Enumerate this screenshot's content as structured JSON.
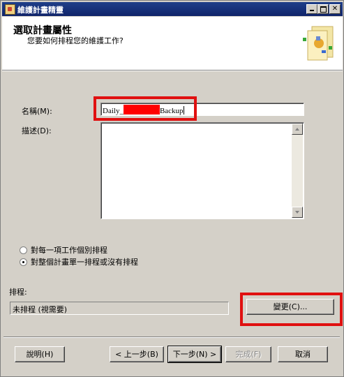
{
  "window": {
    "title": "維護計畫精靈"
  },
  "header": {
    "title": "選取計畫屬性",
    "subtitle": "您要如何排程您的維護工作?"
  },
  "form": {
    "name_label": "名稱(M):",
    "name_value_prefix": "Daily_",
    "name_value_suffix": "Backup",
    "description_label": "描述(D):",
    "description_value": ""
  },
  "schedule_options": [
    {
      "label": "對每一項工作個別排程",
      "selected": false
    },
    {
      "label": "對整個計畫單一排程或沒有排程",
      "selected": true
    }
  ],
  "schedule": {
    "label": "排程:",
    "value": "未排程 (視需要)",
    "change_button": "變更(C)..."
  },
  "footer": {
    "help": "說明(H)",
    "back": "< 上一步(B)",
    "next": "下一步(N) >",
    "finish": "完成(F)",
    "cancel": "取消"
  },
  "colors": {
    "highlight": "#e01010",
    "redaction": "#ff0000",
    "titlebar": "#10246a",
    "window_bg": "#d4d0c8"
  }
}
